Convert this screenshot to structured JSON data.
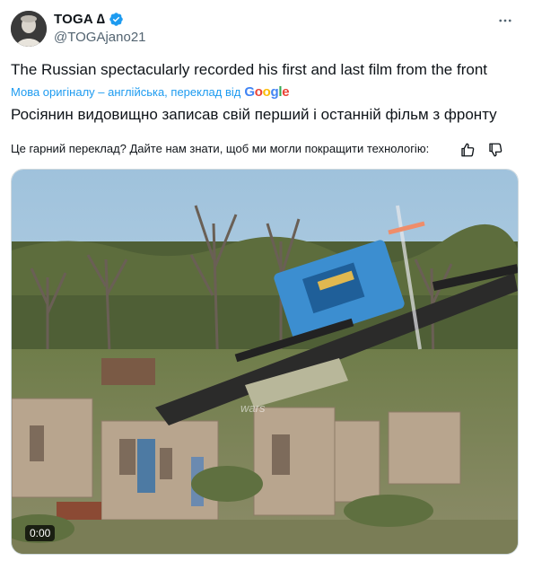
{
  "author": {
    "display_name": "TOGA ∆",
    "handle": "@TOGAjano21"
  },
  "tweet": {
    "text": "The Russian spectacularly recorded his first and last film from the front",
    "translation_note": "Мова оригіналу – англійська, переклад від",
    "translation_provider": "Google",
    "translated_text": "Росіянин видовищно записав свій перший і останній фільм з фронту",
    "feedback_prompt": "Це гарний переклад? Дайте нам знати, щоб ми могли покращити технологію:"
  },
  "media": {
    "timecode": "0:00",
    "watermark": "wars"
  },
  "colors": {
    "accent": "#1d9bf0",
    "secondary_text": "#536471",
    "primary_text": "#0f1419"
  },
  "icons": {
    "verified": "verified-badge-icon",
    "more": "more-options-icon",
    "thumbs_up": "thumbs-up-icon",
    "thumbs_down": "thumbs-down-icon"
  }
}
